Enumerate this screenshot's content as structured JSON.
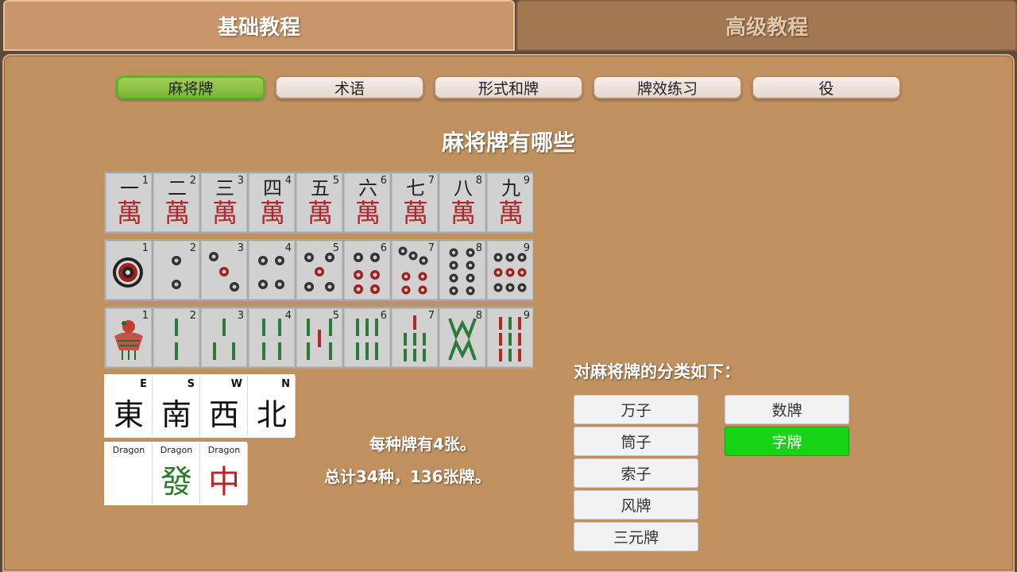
{
  "top_tabs": [
    {
      "label": "基础教程",
      "active": true
    },
    {
      "label": "高级教程",
      "active": false
    }
  ],
  "sub_tabs": [
    {
      "label": "麻将牌",
      "active": true
    },
    {
      "label": "术语",
      "active": false
    },
    {
      "label": "形式和牌",
      "active": false
    },
    {
      "label": "牌效练习",
      "active": false
    },
    {
      "label": "役",
      "active": false
    }
  ],
  "section_title": "麻将牌有哪些",
  "tiles": {
    "man": {
      "numbers": [
        "1",
        "2",
        "3",
        "4",
        "5",
        "6",
        "7",
        "8",
        "9"
      ],
      "top_chars": [
        "一",
        "二",
        "三",
        "四",
        "五",
        "六",
        "七",
        "八",
        "九"
      ],
      "suit_char": "萬"
    },
    "pin": {
      "numbers": [
        "1",
        "2",
        "3",
        "4",
        "5",
        "6",
        "7",
        "8",
        "9"
      ]
    },
    "sou": {
      "numbers": [
        "1",
        "2",
        "3",
        "4",
        "5",
        "6",
        "7",
        "8",
        "9"
      ]
    },
    "winds": [
      {
        "letter": "E",
        "char": "東"
      },
      {
        "letter": "S",
        "char": "南"
      },
      {
        "letter": "W",
        "char": "西"
      },
      {
        "letter": "N",
        "char": "北"
      }
    ],
    "dragons": [
      {
        "label": "Dragon",
        "char": "",
        "color": "#ffffff"
      },
      {
        "label": "Dragon",
        "char": "發",
        "color": "#2a7a2a"
      },
      {
        "label": "Dragon",
        "char": "中",
        "color": "#c02020"
      }
    ]
  },
  "info": {
    "line1": "每种牌有4张。",
    "line2": "总计34种，136张牌。"
  },
  "classification": {
    "title": "对麻将牌的分类如下：",
    "suit_buttons": [
      "万子",
      "筒子",
      "索子",
      "风牌",
      "三元牌"
    ],
    "group_buttons": [
      {
        "label": "数牌",
        "highlighted": false
      },
      {
        "label": "字牌",
        "highlighted": true
      }
    ]
  },
  "colors": {
    "panel": "#c0905f",
    "active_subtab": "#8cc443",
    "highlight_green": "#17d417",
    "wan_red": "#b02828"
  }
}
